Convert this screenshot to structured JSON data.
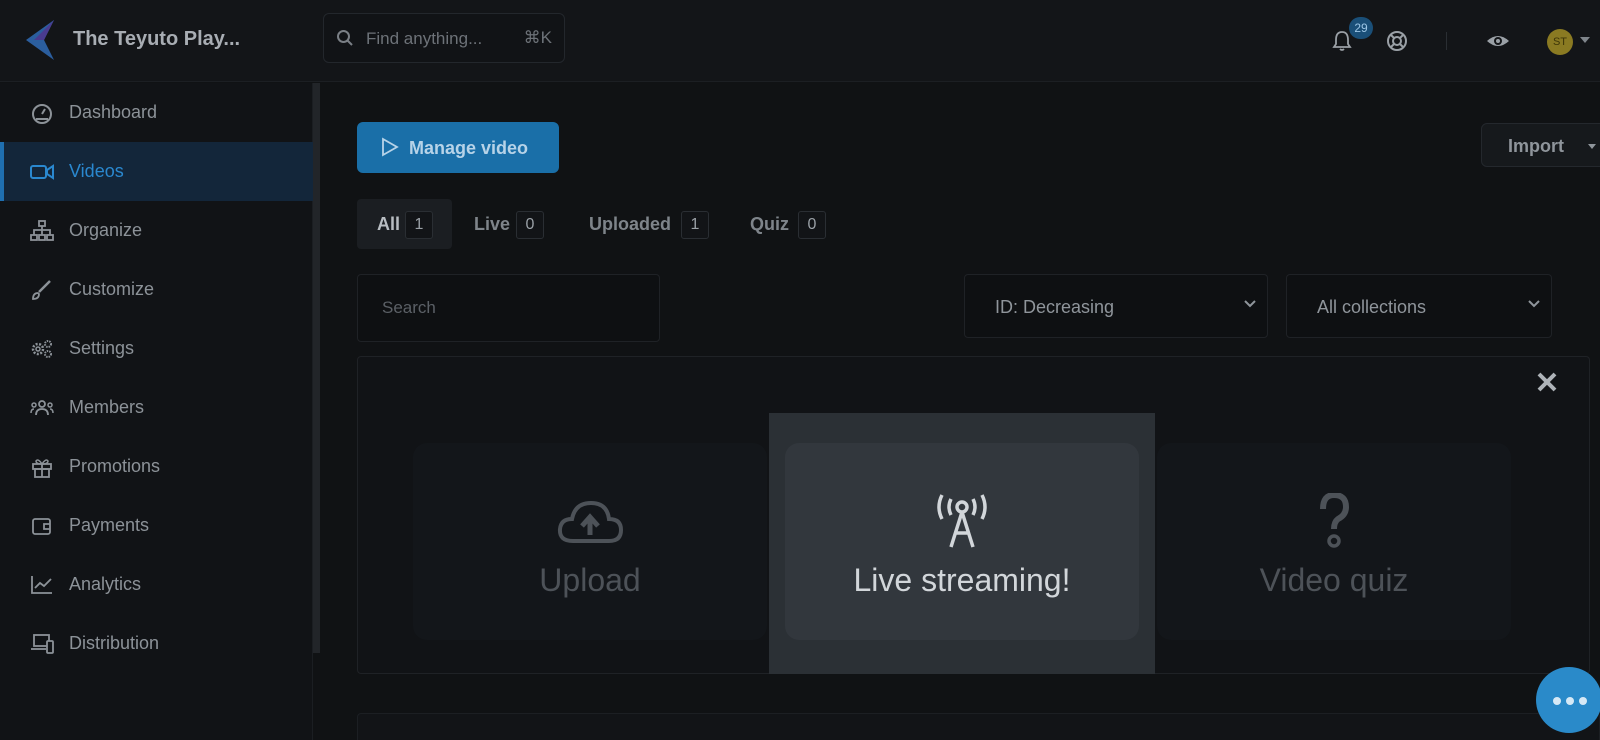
{
  "header": {
    "brand": "The Teyuto Play...",
    "search_placeholder": "Find anything...",
    "search_shortcut": "⌘K",
    "notification_count": "29",
    "avatar_initials": "ST"
  },
  "sidebar": {
    "items": [
      {
        "label": "Dashboard",
        "icon": "dashboard-icon"
      },
      {
        "label": "Videos",
        "icon": "video-camera-icon",
        "active": true
      },
      {
        "label": "Organize",
        "icon": "sitemap-icon"
      },
      {
        "label": "Customize",
        "icon": "brush-icon"
      },
      {
        "label": "Settings",
        "icon": "gears-icon"
      },
      {
        "label": "Members",
        "icon": "users-icon"
      },
      {
        "label": "Promotions",
        "icon": "gift-icon"
      },
      {
        "label": "Payments",
        "icon": "wallet-icon"
      },
      {
        "label": "Analytics",
        "icon": "chart-icon"
      },
      {
        "label": "Distribution",
        "icon": "devices-icon"
      }
    ]
  },
  "main": {
    "manage_label": "Manage video",
    "import_label": "Import",
    "tabs": [
      {
        "label": "All",
        "count": "1"
      },
      {
        "label": "Live",
        "count": "0"
      },
      {
        "label": "Uploaded",
        "count": "1"
      },
      {
        "label": "Quiz",
        "count": "0"
      }
    ],
    "search_placeholder": "Search",
    "sort_value": "ID: Decreasing",
    "collection_value": "All collections",
    "cards": [
      {
        "label": "Upload",
        "icon": "cloud-upload-icon"
      },
      {
        "label": "Live streaming!",
        "icon": "antenna-icon"
      },
      {
        "label": "Video quiz",
        "icon": "question-icon"
      }
    ]
  },
  "colors": {
    "accent": "#1a6fa8",
    "active_nav": "#2a88cf",
    "highlight": "#2b3035"
  }
}
